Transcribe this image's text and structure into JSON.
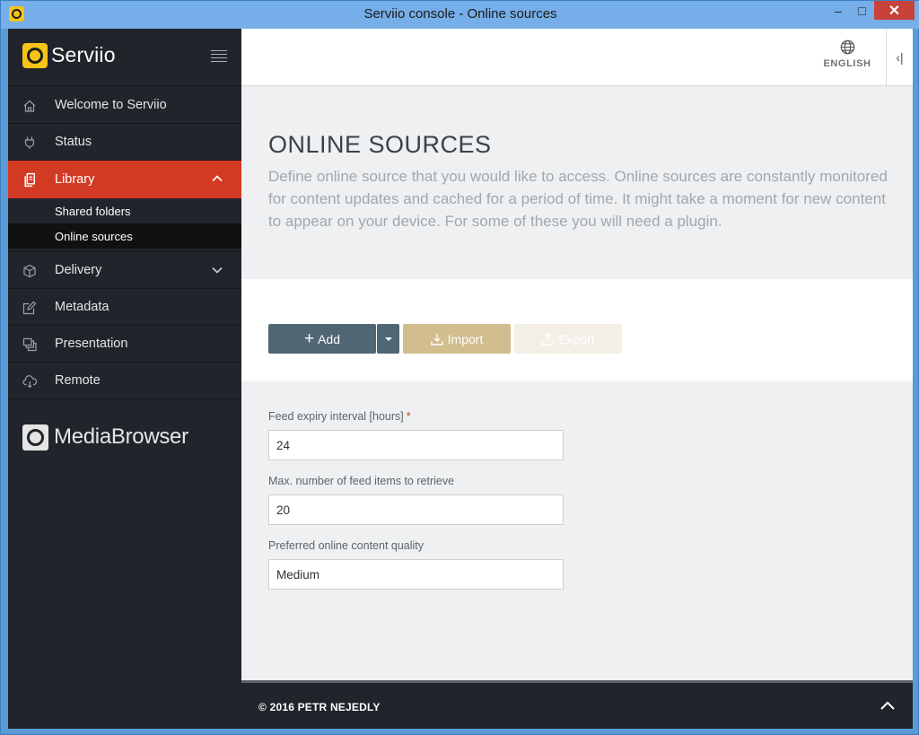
{
  "window": {
    "title": "Serviio console - Online sources",
    "minimize_label": "–",
    "maximize_label": "□",
    "close_label": "✕"
  },
  "brand": {
    "name": "Serviio"
  },
  "nav": {
    "items": [
      {
        "label": "Welcome to Serviio",
        "icon": "home-icon"
      },
      {
        "label": "Status",
        "icon": "plug-icon"
      },
      {
        "label": "Library",
        "icon": "library-icon",
        "active": true,
        "expanded": true
      },
      {
        "label": "Delivery",
        "icon": "box-icon"
      },
      {
        "label": "Metadata",
        "icon": "edit-icon"
      },
      {
        "label": "Presentation",
        "icon": "presentation-icon"
      },
      {
        "label": "Remote",
        "icon": "cloud-icon"
      }
    ],
    "library_sub": [
      {
        "label": "Shared folders"
      },
      {
        "label": "Online sources",
        "selected": true
      }
    ]
  },
  "media_browser": {
    "label": "MediaBrowser"
  },
  "header": {
    "language": "ENGLISH",
    "collapse_label": "‹|"
  },
  "page": {
    "title": "ONLINE SOURCES",
    "description": "Define online source that you would like to access. Online sources are constantly monitored for content updates and cached for a period of time. It might take a moment for new content to appear on your device. For some of these you will need a plugin."
  },
  "toolbar": {
    "add_label": "Add",
    "import_label": "Import",
    "export_label": "Export"
  },
  "form": {
    "expiry_label": "Feed expiry interval [hours]",
    "expiry_required": "*",
    "expiry_value": "24",
    "max_items_label": "Max. number of feed items to retrieve",
    "max_items_value": "20",
    "quality_label": "Preferred online content quality",
    "quality_value": "Medium"
  },
  "footer": {
    "copyright": "© 2016 PETR NEJEDLY"
  },
  "colors": {
    "accent": "#d33a23",
    "sidebar_bg": "#21252b",
    "brand_yellow": "#f6c416",
    "add_button": "#4f6674",
    "import_button": "#d1bd8e"
  }
}
